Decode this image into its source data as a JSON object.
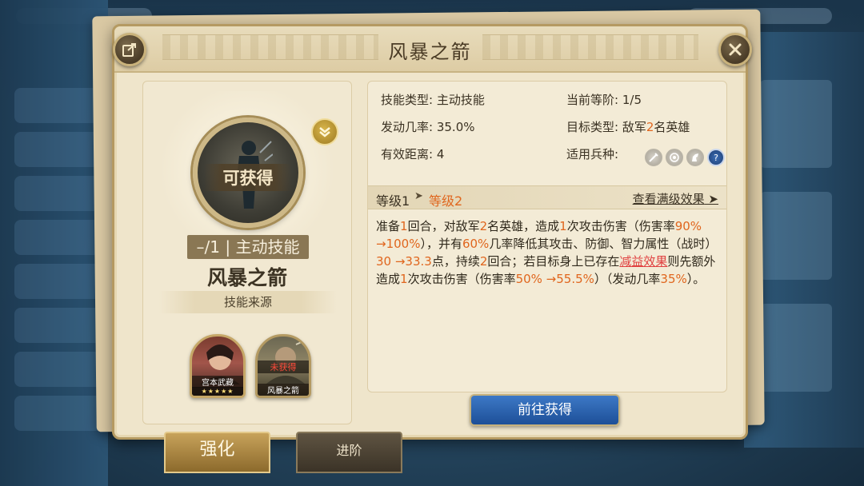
{
  "dialog": {
    "title": "风暴之箭"
  },
  "icons": {
    "share": "share-icon",
    "close": "close-icon",
    "expand": "chevron-down-icon"
  },
  "skill": {
    "medal_label": "可获得",
    "type_badge": "–/1 | 主动技能",
    "name": "风暴之箭",
    "source_label": "技能来源"
  },
  "heroes": [
    {
      "name": "宫本武藏",
      "stars": "★★★★★",
      "status": ""
    },
    {
      "name": "风暴之箭",
      "stars": "",
      "status": "未获得"
    }
  ],
  "info": {
    "skill_type_key": "技能类型:",
    "skill_type_val": "主动技能",
    "current_tier_key": "当前等阶:",
    "current_tier_val": "1/5",
    "trigger_rate_key": "发动几率:",
    "trigger_rate_val": "35.0%",
    "target_type_key": "目标类型:",
    "target_type_pre": "敌军",
    "target_type_num": "2",
    "target_type_post": "名英雄",
    "range_key": "有效距离:",
    "range_val": "4",
    "troop_key": "适用兵种:",
    "troop_icons": [
      "sword-icon",
      "target-icon",
      "horse-icon",
      "help-icon"
    ]
  },
  "levels": {
    "current": "等级1",
    "next": "等级2",
    "max_link": "查看满级效果"
  },
  "description": [
    {
      "t": "准备",
      "c": "n"
    },
    {
      "t": "1",
      "c": "o"
    },
    {
      "t": "回合，对敌军",
      "c": "n"
    },
    {
      "t": "2",
      "c": "o"
    },
    {
      "t": "名英雄，造成",
      "c": "n"
    },
    {
      "t": "1",
      "c": "o"
    },
    {
      "t": "次攻击伤害（伤害率",
      "c": "n"
    },
    {
      "t": "90% →100%",
      "c": "o"
    },
    {
      "t": "），并有",
      "c": "n"
    },
    {
      "t": "60%",
      "c": "o"
    },
    {
      "t": "几率降低其攻击、防御、智力属性（战时）",
      "c": "n"
    },
    {
      "t": "30 →33.3",
      "c": "o"
    },
    {
      "t": "点，持续",
      "c": "n"
    },
    {
      "t": "2",
      "c": "o"
    },
    {
      "t": "回合；若目标身上已存在",
      "c": "n"
    },
    {
      "t": "减益效果",
      "c": "r"
    },
    {
      "t": "则先额外造成",
      "c": "n"
    },
    {
      "t": "1",
      "c": "o"
    },
    {
      "t": "次攻击伤害（伤害率",
      "c": "n"
    },
    {
      "t": "50% →55.5%",
      "c": "o"
    },
    {
      "t": "）（发动几率",
      "c": "n"
    },
    {
      "t": "35%",
      "c": "o"
    },
    {
      "t": "）。",
      "c": "n"
    }
  ],
  "actions": {
    "goto_label": "前往获得"
  },
  "tabs": {
    "strengthen": "强化",
    "advance": "进阶"
  },
  "colors": {
    "accent_orange": "#e0661e",
    "debuff_red": "#e04040",
    "button_blue": "#1d4f98"
  }
}
